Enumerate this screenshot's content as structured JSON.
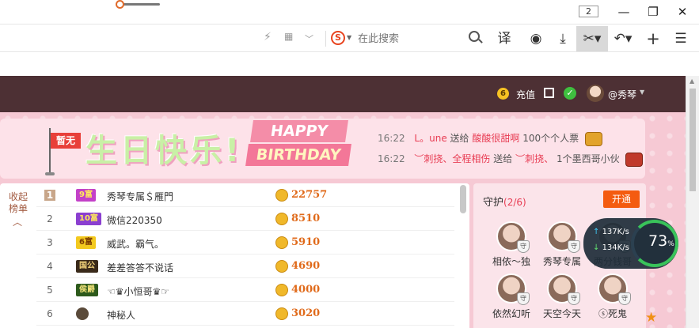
{
  "titlebar": {
    "tab_count": "2",
    "minimize_glyph": "—",
    "restore_glyph": "❐",
    "close_glyph": "✕"
  },
  "addressbar": {
    "search_engine_logo": "S",
    "search_placeholder": "在此搜索",
    "translate_label": "译",
    "icons": [
      "flash-icon",
      "qr-code-icon",
      "chevron-down-icon",
      "search-icon",
      "translate-icon",
      "media-icon",
      "download-icon",
      "screenshot-scissors-icon",
      "undo-icon",
      "new-tab-plus-icon",
      "menu-icon"
    ]
  },
  "header": {
    "coin_glyph": "6",
    "recharge_label": "充值",
    "username": "@秀琴"
  },
  "banner": {
    "flag_label": "暂无",
    "title_cn": "生日快乐!",
    "happy": "HAPPY",
    "birthday": "BIRTHDAY",
    "gifts": [
      {
        "time": "16:22",
        "from": "L。une",
        "verb": "送给",
        "to": "酸酸很甜啊",
        "gift": "100个个人票"
      },
      {
        "time": "16:22",
        "from": "︶刺挠、全程相伤",
        "verb": "送给",
        "to": "︶刺挠、",
        "gift": "1个墨西哥小伙"
      }
    ]
  },
  "rank": {
    "collapse_label": "收起榜单",
    "collapse_glyph": "︿",
    "rows": [
      {
        "rank": "1",
        "badge": "9富",
        "badge_bg": "#c341c8",
        "badge_fg": "#ffea5a",
        "name": "秀琴专属＄雁門",
        "score": "22757"
      },
      {
        "rank": "2",
        "badge": "10富",
        "badge_bg": "#8b3fd0",
        "badge_fg": "#ffea5a",
        "name": "微信220350",
        "score": "8510"
      },
      {
        "rank": "3",
        "badge": "6富",
        "badge_bg": "#f3c91e",
        "badge_fg": "#7a3a00",
        "name": "威武。霸气。",
        "score": "5910"
      },
      {
        "rank": "4",
        "badge": "国公",
        "badge_bg": "#3a2a1a",
        "badge_fg": "#f3d37a",
        "name": "差差答答不说话",
        "score": "4690"
      },
      {
        "rank": "5",
        "badge": "侯爵",
        "badge_bg": "#2d5a1c",
        "badge_fg": "#f3e37a",
        "name": "☜♛小恒哥♛☞",
        "score": "4000"
      },
      {
        "rank": "6",
        "badge": "",
        "badge_bg": "#ffffff",
        "badge_fg": "#333333",
        "name": "神秘人",
        "score": "3020"
      }
    ]
  },
  "guard": {
    "title": "守护",
    "count": "(2/6)",
    "open_label": "开通",
    "items": [
      {
        "name": "相依～独"
      },
      {
        "name": "秀琴专属"
      },
      {
        "name": "两分钱哥"
      },
      {
        "name": "依然幻听"
      },
      {
        "name": "天空今天"
      },
      {
        "name": "ⓢ死鬼"
      }
    ]
  },
  "speed": {
    "up": "137K/s",
    "down": "134K/s",
    "percent": "73",
    "percent_unit": "%"
  }
}
